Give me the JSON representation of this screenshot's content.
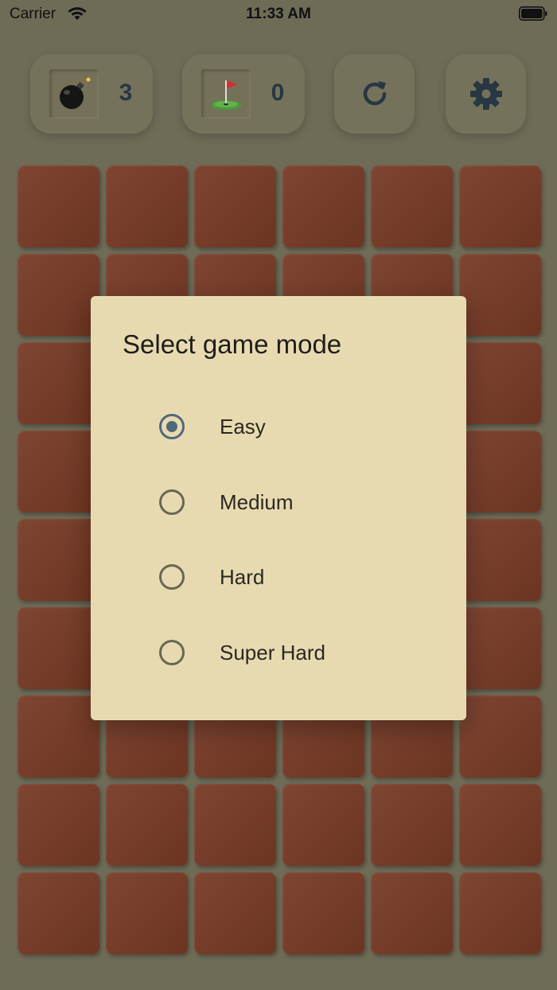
{
  "status_bar": {
    "carrier": "Carrier",
    "time": "11:33 AM"
  },
  "toolbar": {
    "mines_count": "3",
    "flags_count": "0",
    "mine_icon": "bomb-icon",
    "flag_icon": "golf-flag-icon",
    "restart_icon": "restart-icon",
    "settings_icon": "gear-icon"
  },
  "board": {
    "columns": 6,
    "rows": 9
  },
  "dialog": {
    "title": "Select game mode",
    "options": [
      {
        "label": "Easy",
        "selected": true
      },
      {
        "label": "Medium",
        "selected": false
      },
      {
        "label": "Hard",
        "selected": false
      },
      {
        "label": "Super Hard",
        "selected": false
      }
    ]
  },
  "colors": {
    "background": "#6e6b57",
    "tile": "#7a412e",
    "dialog": "#e8dab0",
    "accent": "#51687a",
    "counter_text": "#283744"
  }
}
